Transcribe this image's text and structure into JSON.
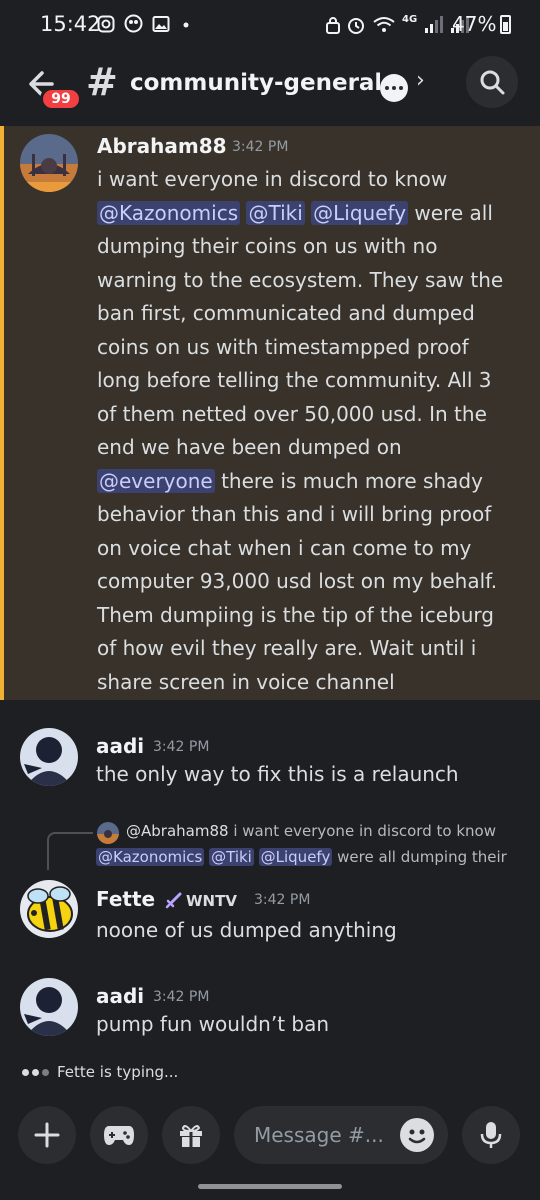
{
  "status_bar": {
    "time": "15:42",
    "network": "4G",
    "battery": "47%",
    "icons": [
      "instagram-icon",
      "app-icon",
      "gallery-icon",
      "dot-icon",
      "lock-icon",
      "alarm-icon",
      "wifi-icon",
      "signal-icon",
      "signal-icon",
      "battery-icon"
    ]
  },
  "header": {
    "channel_name": "community-general-",
    "unread_badge": "99",
    "icons": [
      "back-arrow-icon",
      "hash-icon",
      "speech-bubble-icon",
      "chevron-right-icon",
      "search-icon"
    ]
  },
  "messages": [
    {
      "author": "Abraham88",
      "time": "3:42 PM",
      "highlighted": true,
      "lines": [
        [
          {
            "t": "i want everyone in discord to know"
          }
        ],
        [
          {
            "t": "@Kazonomics",
            "m": true
          },
          {
            "t": " "
          },
          {
            "t": "@Tiki",
            "m": true
          },
          {
            "t": " "
          },
          {
            "t": "@Liquefy",
            "m": true
          },
          {
            "t": " were all"
          }
        ],
        [
          {
            "t": "dumping their coins on us with no"
          }
        ],
        [
          {
            "t": "warning to the ecosystem. They saw the"
          }
        ],
        [
          {
            "t": "ban first, communicated and dumped"
          }
        ],
        [
          {
            "t": "coins on us with timestampped proof"
          }
        ],
        [
          {
            "t": "long before telling the community. All 3"
          }
        ],
        [
          {
            "t": "of them netted over 50,000 usd. In the"
          }
        ],
        [
          {
            "t": "end we have been dumped on"
          }
        ],
        [
          {
            "t": "@everyone",
            "m": true
          },
          {
            "t": " there is much more shady"
          }
        ],
        [
          {
            "t": "behavior than this and i will bring proof"
          }
        ],
        [
          {
            "t": "on voice chat when i can come to my"
          }
        ],
        [
          {
            "t": "computer 93,000 usd lost on my behalf."
          }
        ],
        [
          {
            "t": "Them dumpiing is the tip of the iceburg"
          }
        ],
        [
          {
            "t": "of how evil they really are. Wait until i"
          }
        ],
        [
          {
            "t": "share screen in voice channel"
          }
        ]
      ]
    },
    {
      "author": "aadi",
      "time": "3:42 PM",
      "text": "the only way to fix this is a relaunch"
    },
    {
      "reply": {
        "author": "@Abraham88",
        "text": "i want everyone in discord to know",
        "mentions": [
          "@Kazonomics",
          "@Tiki",
          "@Liquefy"
        ],
        "continuation": "were all dumping their"
      },
      "author": "Fette",
      "role_tag": "WNTV",
      "time": "3:42 PM",
      "text": "noone of us dumped anything"
    },
    {
      "author": "aadi",
      "time": "3:42 PM",
      "text": "pump fun wouldn’t ban"
    }
  ],
  "typing": {
    "text": "Fette is typing..."
  },
  "composer": {
    "placeholder": "Message #...",
    "buttons": [
      "plus-icon",
      "gamepad-icon",
      "gift-icon",
      "emoji-icon",
      "microphone-icon"
    ]
  },
  "colors": {
    "background": "#1e1f22",
    "highlight_bg": "#38322a",
    "highlight_bar": "#f0b232",
    "mention_bg": "#3c4270",
    "mention_text": "#c9cdfb",
    "badge": "#f23f42"
  }
}
